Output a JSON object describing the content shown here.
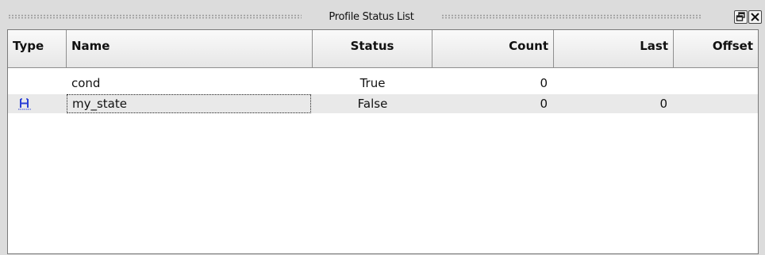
{
  "window": {
    "title": "Profile Status List",
    "float_icon": "float-window-icon",
    "close_icon": "close-icon"
  },
  "columns": [
    {
      "key": "type",
      "label": "Type"
    },
    {
      "key": "name",
      "label": "Name"
    },
    {
      "key": "status",
      "label": "Status"
    },
    {
      "key": "count",
      "label": "Count"
    },
    {
      "key": "last",
      "label": "Last"
    },
    {
      "key": "offset",
      "label": "Offset"
    }
  ],
  "rows": [
    {
      "type_icon": "",
      "name": "cond",
      "status": "True",
      "count": "0",
      "last": "",
      "offset": ""
    },
    {
      "type_icon": "state-icon",
      "name": "my_state",
      "status": "False",
      "count": "0",
      "last": "0",
      "offset": ""
    }
  ],
  "colors": {
    "icon_blue": "#2a3fd6",
    "alt_row": "#e9e9e9"
  }
}
